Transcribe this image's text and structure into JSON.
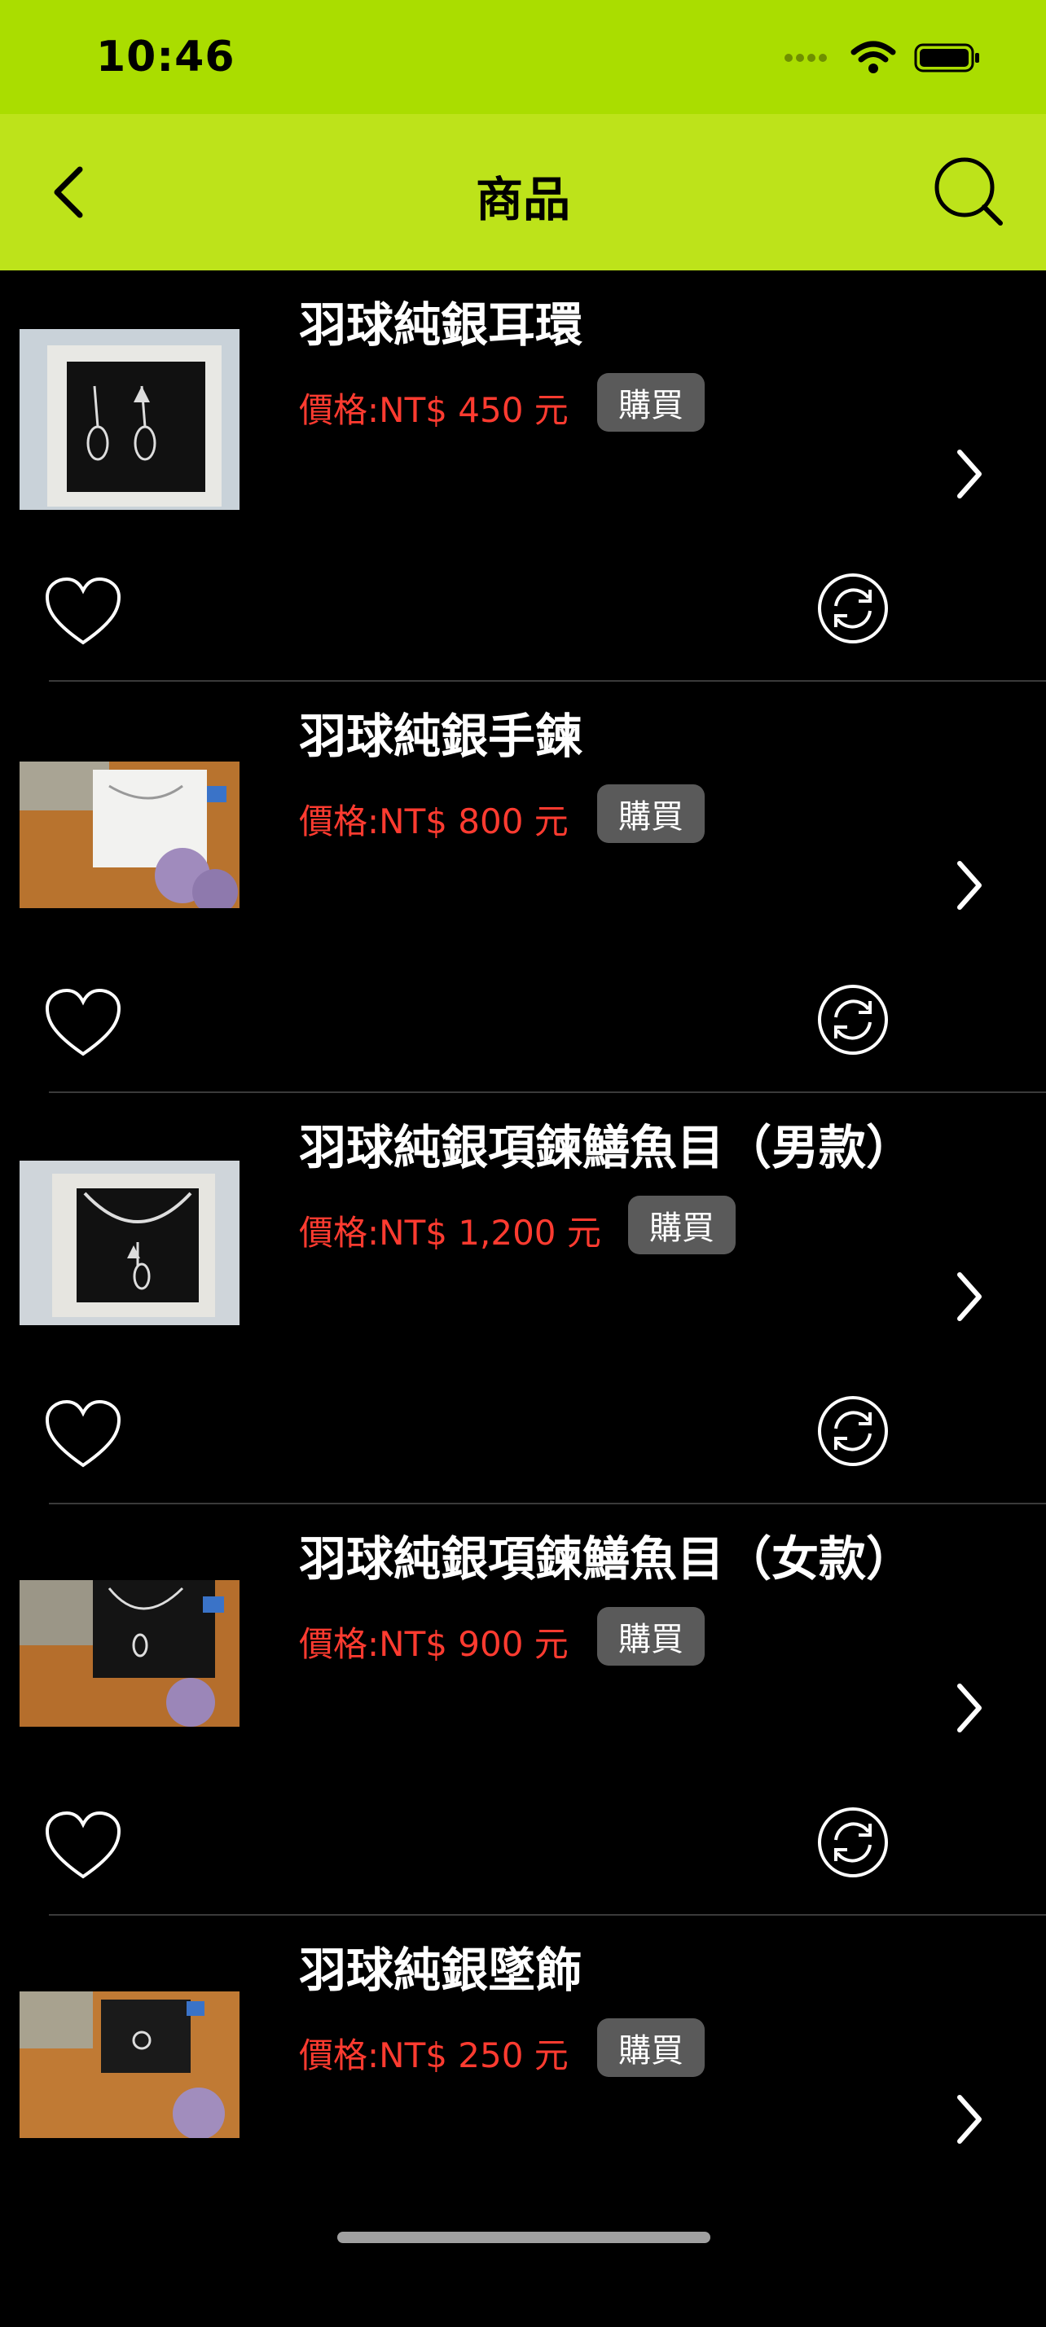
{
  "status_bar": {
    "time": "10:46"
  },
  "nav": {
    "title": "商品"
  },
  "products": [
    {
      "name": "羽球純銀耳環",
      "price": "價格:NT$ 450 元",
      "buy_label": "購買"
    },
    {
      "name": "羽球純銀手鍊",
      "price": "價格:NT$ 800 元",
      "buy_label": "購買"
    },
    {
      "name": "羽球純銀項鍊鱔魚目（男款）",
      "price": "價格:NT$ 1,200 元",
      "buy_label": "購買"
    },
    {
      "name": "羽球純銀項鍊鱔魚目（女款）",
      "price": "價格:NT$ 900 元",
      "buy_label": "購買"
    },
    {
      "name": "羽球純銀墜飾",
      "price": "價格:NT$ 250 元",
      "buy_label": "購買"
    }
  ],
  "colors": {
    "status_bar_bg": "#aadd00",
    "nav_bg": "#bde31a",
    "price_red": "#ff3b30",
    "buy_button_bg": "#5a5a5a"
  }
}
